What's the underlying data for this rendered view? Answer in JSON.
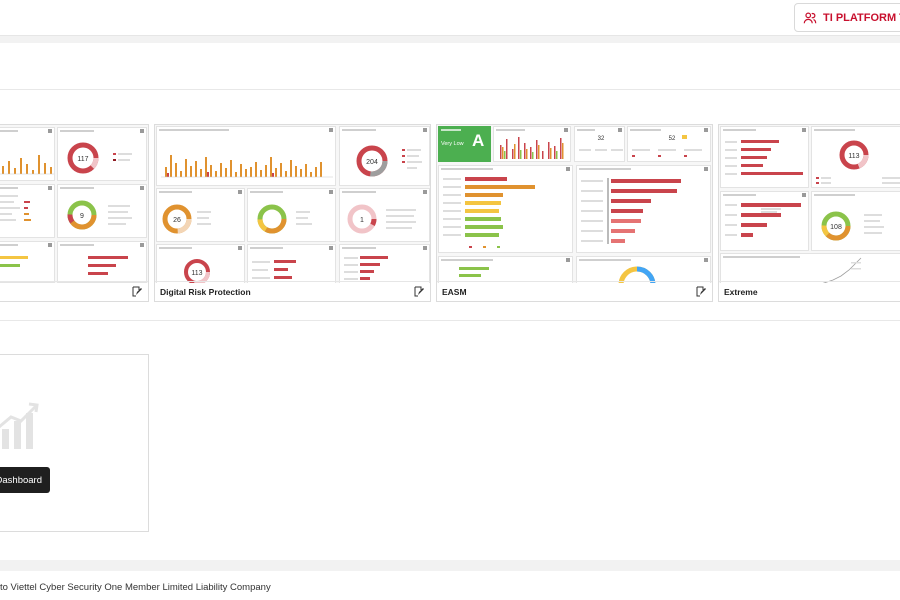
{
  "header": {
    "tenant_button_label": "TI PLATFORM TES"
  },
  "templates": [
    {
      "name": ""
    },
    {
      "name": "Digital Risk Protection"
    },
    {
      "name": "EASM"
    },
    {
      "name": "Extreme"
    }
  ],
  "easm_preview": {
    "grade": "A",
    "risk_label": "Very Low"
  },
  "preview_numbers": {
    "drp_donut_1": "117",
    "drp_donut_2": "204",
    "left_donut": "9",
    "drp_donut_3": "26",
    "drp_donut_4": "1",
    "drp_donut_5": "113",
    "easm_stat_1": "32",
    "easm_stat_2": "52",
    "extreme_donut_1": "113",
    "extreme_donut_2": "108"
  },
  "create": {
    "button_label": "Dashboard"
  },
  "footer": {
    "copyright": "to Viettel Cyber Security One Member Limited Liability Company"
  },
  "colors": {
    "brand_red": "#c8102e",
    "bar_red": "#c9444c",
    "bar_orange": "#e0922f",
    "green": "#4caf50"
  }
}
